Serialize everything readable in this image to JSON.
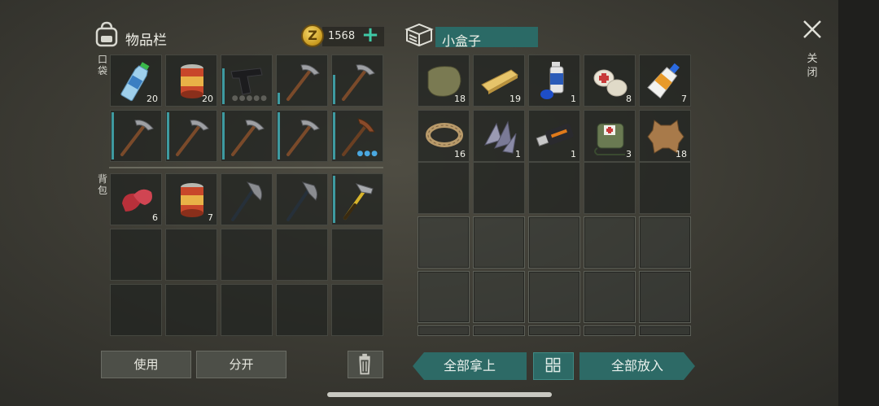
{
  "header": {
    "inventory_title": "物品栏",
    "money": "1568",
    "add_symbol": "+",
    "coin_symbol": "Z"
  },
  "sections": {
    "pocket_label": "口袋",
    "backpack_label": "背包"
  },
  "pocket_slots": [
    {
      "item": "water-bottle-icon",
      "qty": "20"
    },
    {
      "item": "canned-food-icon",
      "qty": "20"
    },
    {
      "item": "pistol-icon",
      "qty": ""
    },
    {
      "item": "pickaxe-icon",
      "qty": ""
    },
    {
      "item": "pickaxe-icon",
      "qty": ""
    },
    {
      "item": "pickaxe-icon",
      "qty": ""
    },
    {
      "item": "pickaxe-icon",
      "qty": ""
    },
    {
      "item": "pickaxe-icon",
      "qty": ""
    },
    {
      "item": "pickaxe-icon",
      "qty": ""
    },
    {
      "item": "crafted-pickaxe-icon",
      "qty": ""
    }
  ],
  "backpack_slots": [
    {
      "item": "raw-meat-icon",
      "qty": "6"
    },
    {
      "item": "canned-food-icon",
      "qty": "7"
    },
    {
      "item": "hatchet-icon",
      "qty": ""
    },
    {
      "item": "hatchet-icon",
      "qty": ""
    },
    {
      "item": "hammer-icon",
      "qty": ""
    }
  ],
  "container": {
    "name": "小盒子",
    "slots": [
      {
        "item": "cloth-icon",
        "qty": "18"
      },
      {
        "item": "plank-icon",
        "qty": "19"
      },
      {
        "item": "spray-can-icon",
        "qty": "1"
      },
      {
        "item": "bandage-icon",
        "qty": "8"
      },
      {
        "item": "glue-icon",
        "qty": "7"
      },
      {
        "item": "rope-icon",
        "qty": "16"
      },
      {
        "item": "scrap-metal-icon",
        "qty": "1"
      },
      {
        "item": "usb-drive-icon",
        "qty": "1"
      },
      {
        "item": "first-aid-bag-icon",
        "qty": "3"
      },
      {
        "item": "leather-hide-icon",
        "qty": "18"
      }
    ]
  },
  "close": {
    "label": "关闭"
  },
  "buttons": {
    "use": "使用",
    "split": "分开",
    "take_all": "全部拿上",
    "put_all": "全部放入"
  },
  "colors": {
    "accent_teal": "#2d6a66",
    "plus_green": "#3fc9a6",
    "durability_bar": "#3e9aa0"
  }
}
